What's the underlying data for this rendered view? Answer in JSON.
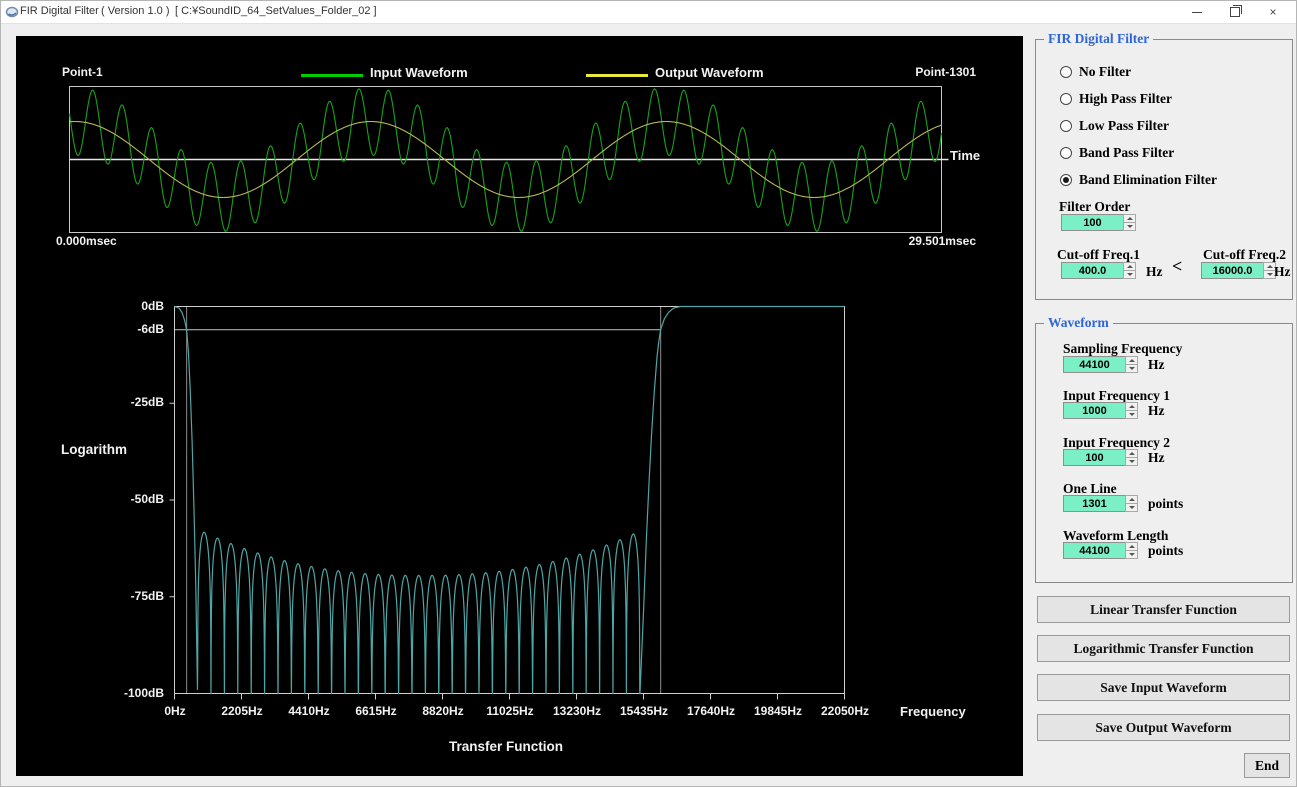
{
  "titlebar": {
    "app_name": "FIR Digital Filter",
    "version": "( Version 1.0 )",
    "path": "[ C:¥SoundID_64_SetValues_Folder_02 ]"
  },
  "waveform_plot": {
    "point_start": "Point-1",
    "point_end": "Point-1301",
    "legend": [
      {
        "label": "Input Waveform"
      },
      {
        "label": "Output Waveform"
      }
    ],
    "axis_label": "Time",
    "time_start": "0.000msec",
    "time_end": "29.501msec"
  },
  "transfer_plot": {
    "ylabel": "Logarithm",
    "xlabel": "Frequency",
    "title": "Transfer Function"
  },
  "chart_data": [
    {
      "type": "line",
      "title": "Input / Output Waveform",
      "xlabel": "Time",
      "x_range_msec": [
        0,
        29.501
      ],
      "point_labels": [
        "Point-1",
        "Point-1301"
      ],
      "series": [
        {
          "name": "Input Waveform",
          "color": "#17A317",
          "components": [
            {
              "freq_hz": 1000,
              "amplitude": 0.465,
              "phase_rad": 2.9
            },
            {
              "freq_hz": 100,
              "amplitude": 0.52,
              "phase_rad": 1.45
            }
          ]
        },
        {
          "name": "Output Waveform",
          "color": "#B9B954",
          "components": [
            {
              "freq_hz": 100,
              "amplitude": 0.52,
              "phase_rad": 1.45
            }
          ]
        }
      ]
    },
    {
      "type": "line",
      "title": "Transfer Function",
      "xlabel": "Frequency",
      "ylabel": "Logarithm",
      "xlim_hz": [
        0,
        22050
      ],
      "ylim_db": [
        -100,
        0
      ],
      "x_ticks_hz": [
        0,
        2205,
        4410,
        6615,
        8820,
        11025,
        13230,
        15435,
        17640,
        19845,
        22050
      ],
      "x_tick_labels": [
        "0Hz",
        "2205Hz",
        "4410Hz",
        "6615Hz",
        "8820Hz",
        "11025Hz",
        "13230Hz",
        "15435Hz",
        "17640Hz",
        "19845Hz",
        "22050Hz"
      ],
      "y_ticks_db": [
        0,
        -6,
        -25,
        -50,
        -75,
        -100
      ],
      "y_tick_labels": [
        "0dB",
        "-6dB",
        "-25dB",
        "-50dB",
        "-75dB",
        "-100dB"
      ],
      "ref_line_db": -6,
      "cutoff_markers_hz": [
        400,
        16000
      ],
      "curve": {
        "color": "#4FA6A6",
        "passband_db": 0,
        "stop_floor_db": -100,
        "left_transition": [
          [
            0,
            0
          ],
          [
            150,
            -0.4
          ],
          [
            250,
            -1.6
          ],
          [
            330,
            -3.5
          ],
          [
            400,
            -6
          ],
          [
            460,
            -12
          ],
          [
            520,
            -22
          ],
          [
            580,
            -35
          ],
          [
            640,
            -52
          ],
          [
            700,
            -72
          ],
          [
            760,
            -101
          ]
        ],
        "lobe_region_hz": [
          760,
          15313
        ],
        "lobe_spacing_hz": 441,
        "lobe_envelope_db": {
          "edge": -57.5,
          "mid": -69.5,
          "center_hz": 8100,
          "half_span_hz": 7350,
          "exponent": 2.3
        },
        "right_transition": [
          [
            15313,
            -101
          ],
          [
            15430,
            -80
          ],
          [
            15530,
            -60
          ],
          [
            15620,
            -45
          ],
          [
            15700,
            -33
          ],
          [
            15790,
            -22
          ],
          [
            15880,
            -13
          ],
          [
            15940,
            -9
          ],
          [
            16000,
            -6
          ],
          [
            16120,
            -3.2
          ],
          [
            16260,
            -1.5
          ],
          [
            16430,
            -0.4
          ],
          [
            16650,
            0
          ],
          [
            22050,
            0
          ]
        ]
      }
    }
  ],
  "filter_panel": {
    "title": "FIR Digital Filter",
    "options": [
      {
        "label": "No Filter",
        "selected": false
      },
      {
        "label": "High Pass Filter",
        "selected": false
      },
      {
        "label": "Low Pass Filter",
        "selected": false
      },
      {
        "label": "Band Pass Filter",
        "selected": false
      },
      {
        "label": "Band Elimination Filter",
        "selected": true
      }
    ],
    "filter_order": {
      "label": "Filter Order",
      "value": "100"
    },
    "cutoff1": {
      "label": "Cut-off Freq.1",
      "value": "400.0",
      "unit": "Hz"
    },
    "comparator": "<",
    "cutoff2": {
      "label": "Cut-off Freq.2",
      "value": "16000.0",
      "unit": "Hz"
    }
  },
  "waveform_panel": {
    "title": "Waveform",
    "fields": [
      {
        "label": "Sampling Frequency",
        "value": "44100",
        "unit": "Hz"
      },
      {
        "label": "Input Frequency 1",
        "value": "1000",
        "unit": "Hz"
      },
      {
        "label": "Input Frequency 2",
        "value": "100",
        "unit": "Hz"
      },
      {
        "label": "One Line",
        "value": "1301",
        "unit": "points"
      },
      {
        "label": "Waveform Length",
        "value": "44100",
        "unit": "points"
      }
    ]
  },
  "action_buttons": {
    "linear": "Linear Transfer Function",
    "logarithmic": "Logarithmic Transfer Function",
    "save_input": "Save Input Waveform",
    "save_output": "Save Output Waveform",
    "end": "End"
  },
  "colors": {
    "legend_input": "#00CC00",
    "legend_output": "#E9E93D",
    "wave_input": "#17A317",
    "wave_output": "#B9B954",
    "transfer_curve": "#4FA6A6",
    "spin_field_bg": "#7BEFC6",
    "group_title_blue": "#2E66D8",
    "panel_bg": "#EFEFEF"
  }
}
